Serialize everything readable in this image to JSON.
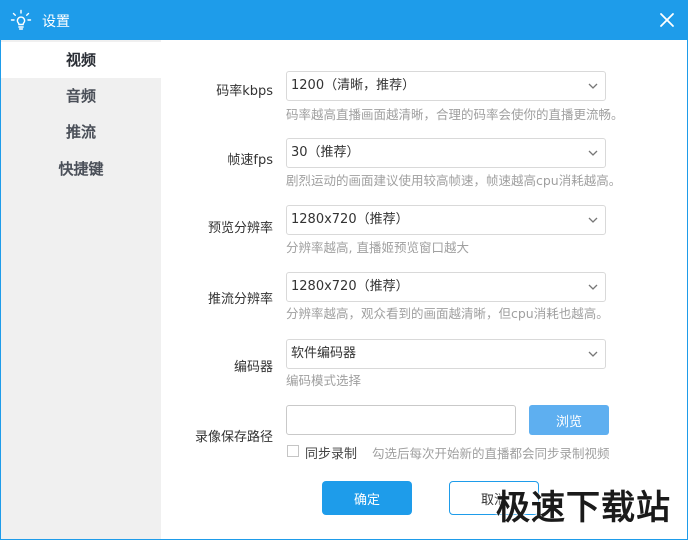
{
  "window": {
    "title": "设置"
  },
  "sidebar": {
    "items": [
      {
        "label": "视频",
        "active": true
      },
      {
        "label": "音频",
        "active": false
      },
      {
        "label": "推流",
        "active": false
      },
      {
        "label": "快捷键",
        "active": false
      }
    ]
  },
  "settings": {
    "bitrate": {
      "label": "码率kbps",
      "value": "1200（清晰，推荐）",
      "hint": "码率越高直播画面越清晰，合理的码率会使你的直播更流畅。"
    },
    "fps": {
      "label": "帧速fps",
      "value": "30（推荐）",
      "hint": "剧烈运动的画面建议使用较高帧速，帧速越高cpu消耗越高。"
    },
    "preview_resolution": {
      "label": "预览分辨率",
      "value": "1280x720（推荐）",
      "hint": "分辨率越高, 直播姬预览窗口越大"
    },
    "stream_resolution": {
      "label": "推流分辨率",
      "value": "1280x720（推荐）",
      "hint": "分辨率越高，观众看到的画面越清晰，但cpu消耗也越高。"
    },
    "encoder": {
      "label": "编码器",
      "value": "软件编码器",
      "hint": "编码模式选择"
    },
    "record_path": {
      "label": "录像保存路径",
      "value": "",
      "browse_label": "浏览"
    },
    "sync_record": {
      "label": "同步录制",
      "checked": false,
      "hint": "勾选后每次开始新的直播都会同步录制视频"
    }
  },
  "footer": {
    "confirm_label": "确定",
    "cancel_label": "取消"
  },
  "watermark": {
    "text": "极速下载站"
  },
  "colors": {
    "accent": "#1e9cea",
    "browse": "#5eaff0",
    "sidebar_bg": "#f0f0f0",
    "hint": "#a0a0a0"
  }
}
